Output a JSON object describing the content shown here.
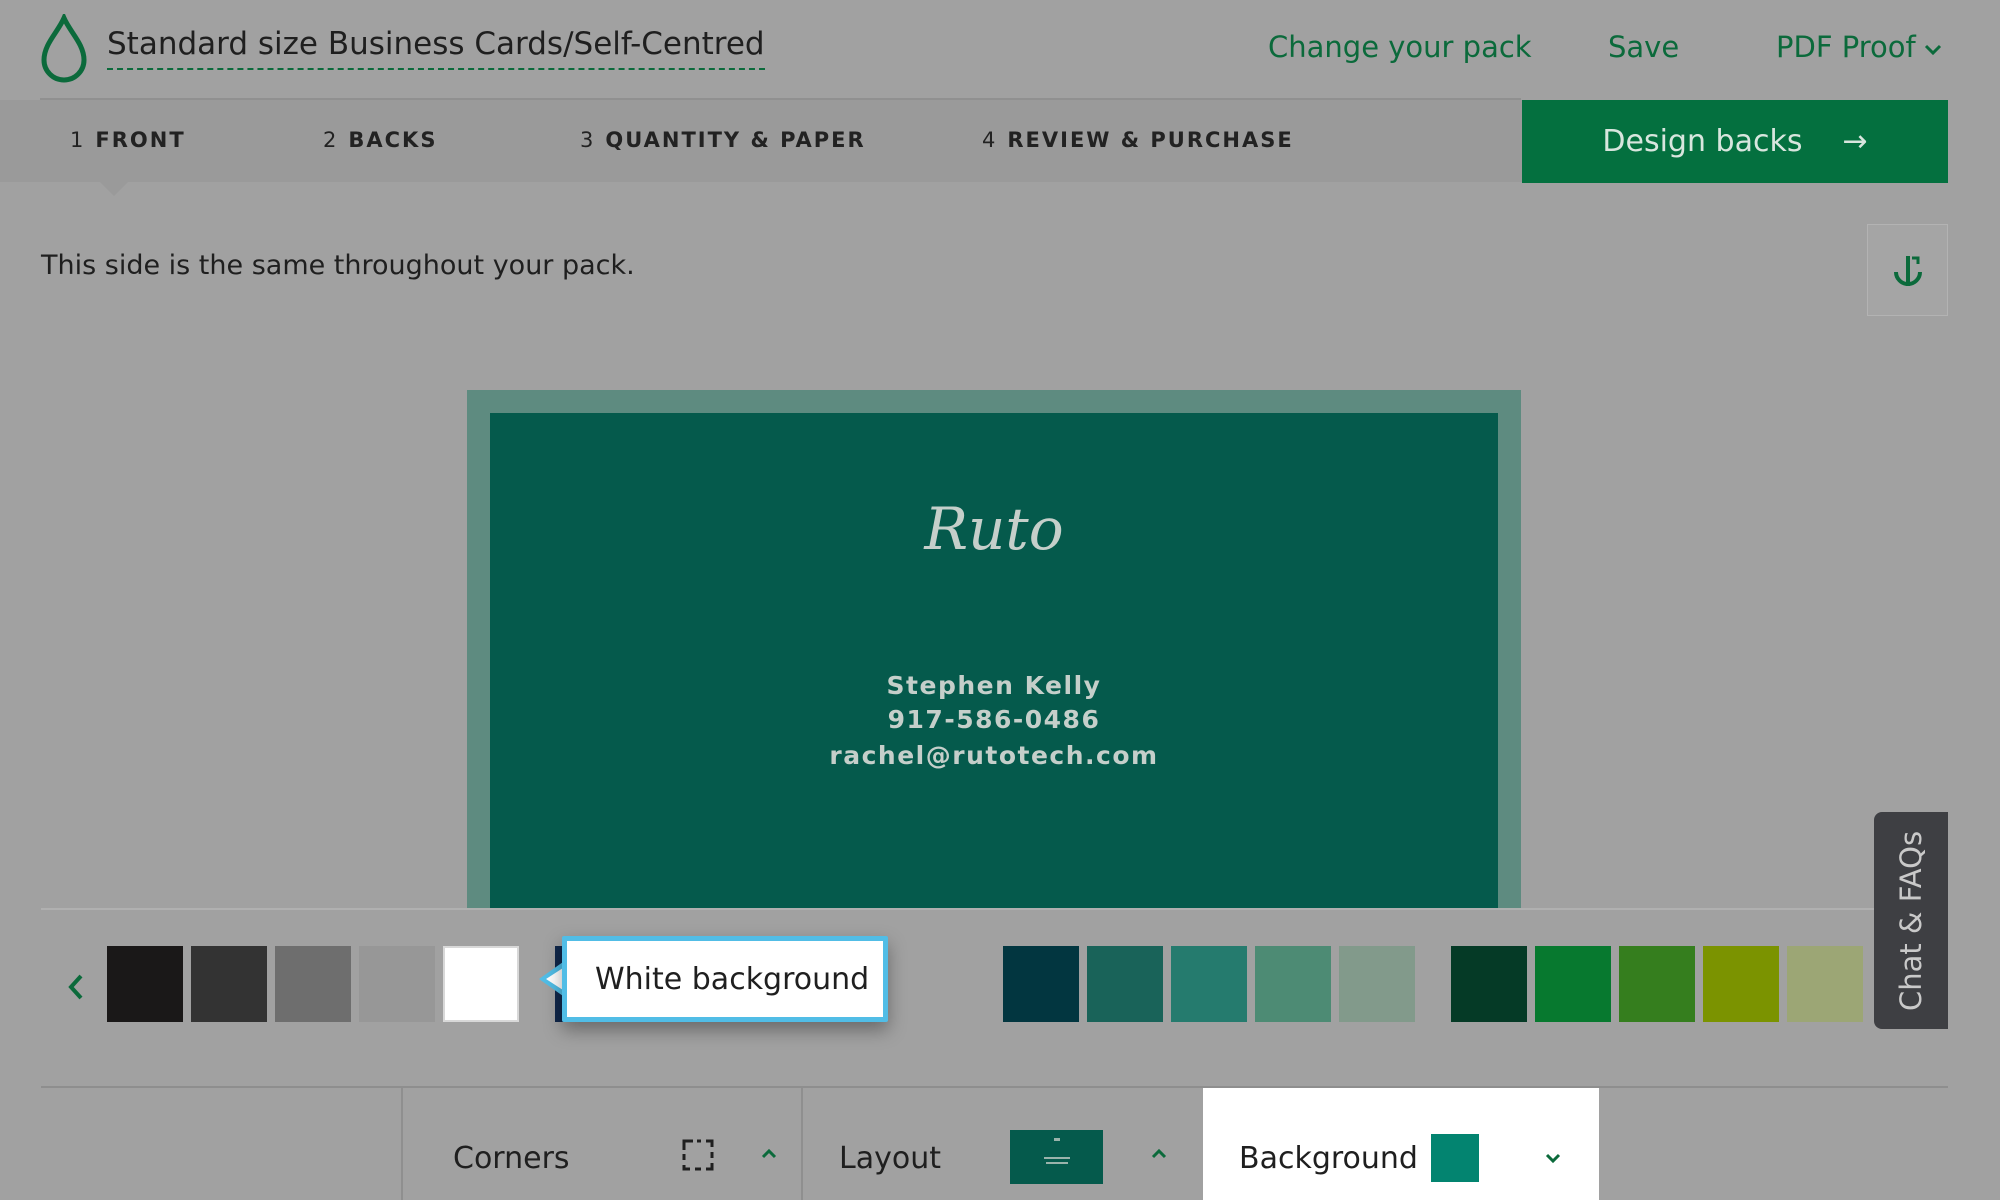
{
  "header": {
    "title": "Standard size Business Cards/Self-Centred",
    "change_pack": "Change your pack",
    "save": "Save",
    "pdf_proof": "PDF Proof"
  },
  "steps": [
    {
      "num": "1",
      "label": "FRONT"
    },
    {
      "num": "2",
      "label": "BACKS"
    },
    {
      "num": "3",
      "label": "QUANTITY & PAPER"
    },
    {
      "num": "4",
      "label": "REVIEW & PURCHASE"
    }
  ],
  "design_backs": {
    "label": "Design backs",
    "arrow": "→"
  },
  "info_text": "This side is the same throughout your pack.",
  "card": {
    "logo": "Ruto",
    "name": "Stephen Kelly",
    "phone": "917-586-0486",
    "email": "rachel@rutotech.com",
    "background_color": "#055a4c"
  },
  "swatches": [
    {
      "name": "black",
      "color": "#1a1818"
    },
    {
      "name": "charcoal",
      "color": "#333333"
    },
    {
      "name": "dark-gray",
      "color": "#6e6e6e"
    },
    {
      "name": "gray",
      "color": "#979797"
    },
    {
      "name": "white",
      "color": "#ffffff"
    },
    {
      "name": "navy",
      "color": "#10274a"
    },
    {
      "name": "slate",
      "color": "#5e6f78"
    },
    {
      "name": "steel",
      "color": "#7b8c92"
    },
    {
      "name": "light-teal-gray",
      "color": "#94a4a4"
    },
    {
      "name": "dark-teal",
      "color": "#023640"
    },
    {
      "name": "deep-teal",
      "color": "#196359"
    },
    {
      "name": "teal",
      "color": "#257b6e"
    },
    {
      "name": "sea-green",
      "color": "#4d8b74"
    },
    {
      "name": "sage",
      "color": "#829a8b"
    },
    {
      "name": "forest",
      "color": "#053a26"
    },
    {
      "name": "green",
      "color": "#07792f"
    },
    {
      "name": "leaf-green",
      "color": "#357e1e"
    },
    {
      "name": "olive",
      "color": "#7b9300"
    },
    {
      "name": "khaki",
      "color": "#9ca675"
    }
  ],
  "tooltip": "White background",
  "chat": "Chat & FAQs",
  "toolbar": {
    "corners": "Corners",
    "layout": "Layout",
    "background": "Background",
    "background_color": "#038470"
  }
}
